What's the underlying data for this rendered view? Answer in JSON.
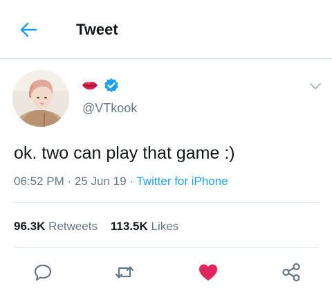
{
  "header": {
    "title": "Tweet",
    "back_icon": "arrow-left-icon"
  },
  "author": {
    "display_name_emoji": "lips-emoji",
    "verified_icon": "verified-badge-icon",
    "handle": "@VTkook",
    "menu_icon": "chevron-down-icon"
  },
  "tweet": {
    "text": "ok. two can play that game :)",
    "time": "06:52 PM",
    "separator": "·",
    "date": "25 Jun 19",
    "source": "Twitter for iPhone"
  },
  "stats": {
    "retweets_count": "96.3K",
    "retweets_label": "Retweets",
    "likes_count": "113.5K",
    "likes_label": "Likes"
  },
  "actions": [
    {
      "icon": "reply-icon"
    },
    {
      "icon": "retweet-icon"
    },
    {
      "icon": "heart-icon",
      "active": true
    },
    {
      "icon": "share-icon"
    }
  ],
  "colors": {
    "accent": "#1da1f2",
    "like": "#e0245e",
    "secondary_text": "#657786",
    "primary_text": "#14171a",
    "divider": "#e1e8ed"
  }
}
